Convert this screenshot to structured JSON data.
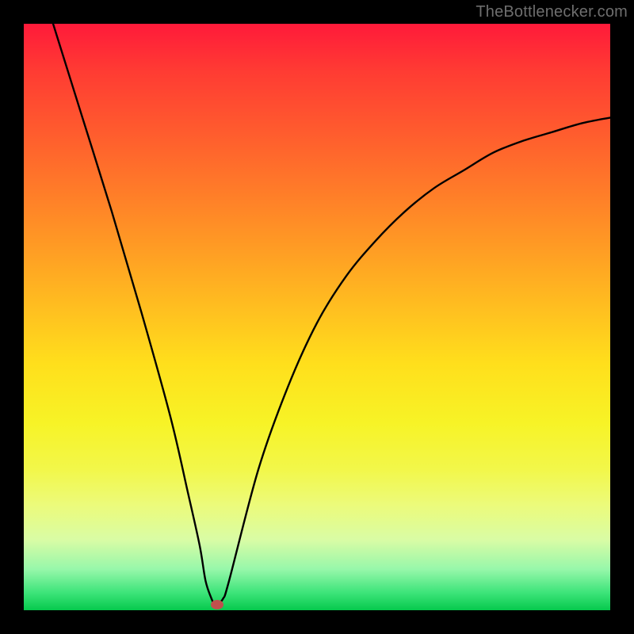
{
  "attribution": "TheBottlenecker.com",
  "colors": {
    "gradient_top": "#ff1a3a",
    "gradient_bottom": "#06c94d",
    "curve": "#000000",
    "marker": "#c0504d",
    "frame": "#000000"
  },
  "chart_data": {
    "type": "line",
    "title": "",
    "xlabel": "",
    "ylabel": "",
    "xlim": [
      0,
      100
    ],
    "ylim": [
      0,
      100
    ],
    "grid": false,
    "legend": false,
    "series": [
      {
        "name": "bottleneck-curve",
        "x": [
          5,
          10,
          15,
          20,
          25,
          28,
          30,
          31,
          32,
          32.5,
          33,
          34,
          35,
          40,
          45,
          50,
          55,
          60,
          65,
          70,
          75,
          80,
          85,
          90,
          95,
          100
        ],
        "y": [
          100,
          84,
          68,
          51,
          33,
          20,
          11,
          5,
          2,
          1,
          1,
          2,
          5,
          24,
          38,
          49,
          57,
          63,
          68,
          72,
          75,
          78,
          80,
          81.5,
          83,
          84
        ]
      }
    ],
    "annotations": [
      {
        "name": "minimum-marker",
        "x": 33,
        "y": 1
      }
    ],
    "notes": "Heat gradient background from red (top, high bottleneck) to green (bottom, low bottleneck). Curve has a sharp V-shaped minimum near x≈33 with a flat bottom at y≈1, then rises with diminishing slope toward the right."
  }
}
